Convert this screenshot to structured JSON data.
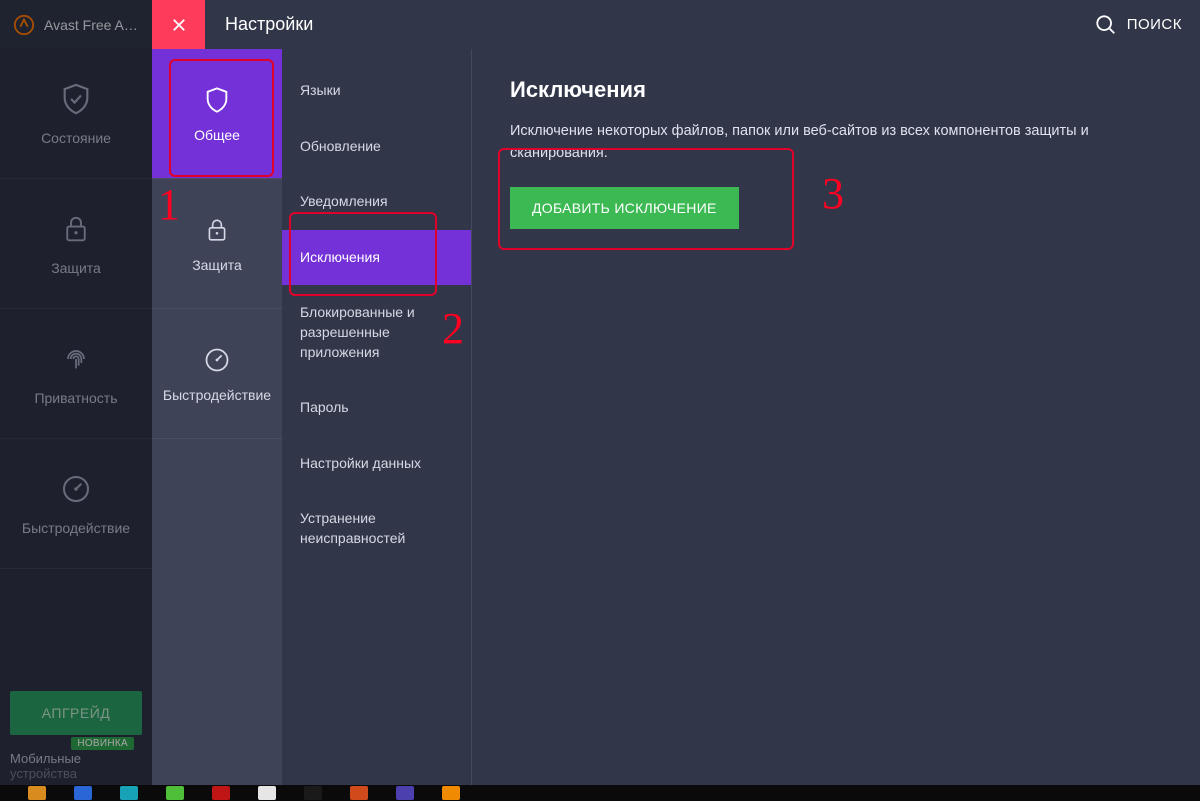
{
  "app": {
    "name": "Avast Free A…"
  },
  "header": {
    "title": "Настройки",
    "search_label": "ПОИСК"
  },
  "left_nav": {
    "items": [
      {
        "label": "Состояние"
      },
      {
        "label": "Защита"
      },
      {
        "label": "Приватность"
      },
      {
        "label": "Быстродействие"
      }
    ],
    "upgrade_label": "АПГРЕЙД",
    "new_badge": "НОВИНКА",
    "mobile_line1": "Мобильные",
    "mobile_line2": "устройства"
  },
  "settings_cats": {
    "items": [
      {
        "label": "Общее"
      },
      {
        "label": "Защита"
      },
      {
        "label": "Быстродействие"
      }
    ]
  },
  "submenu": {
    "items": [
      "Языки",
      "Обновление",
      "Уведомления",
      "Исключения",
      "Блокированные и разрешенные приложения",
      "Пароль",
      "Настройки данных",
      "Устранение неисправностей"
    ]
  },
  "content": {
    "heading": "Исключения",
    "description": "Исключение некоторых файлов, папок или веб-сайтов из всех компонентов защиты и сканирования.",
    "add_button": "ДОБАВИТЬ ИСКЛЮЧЕНИЕ"
  },
  "annotations": {
    "n1": "1",
    "n2": "2",
    "n3": "3"
  }
}
